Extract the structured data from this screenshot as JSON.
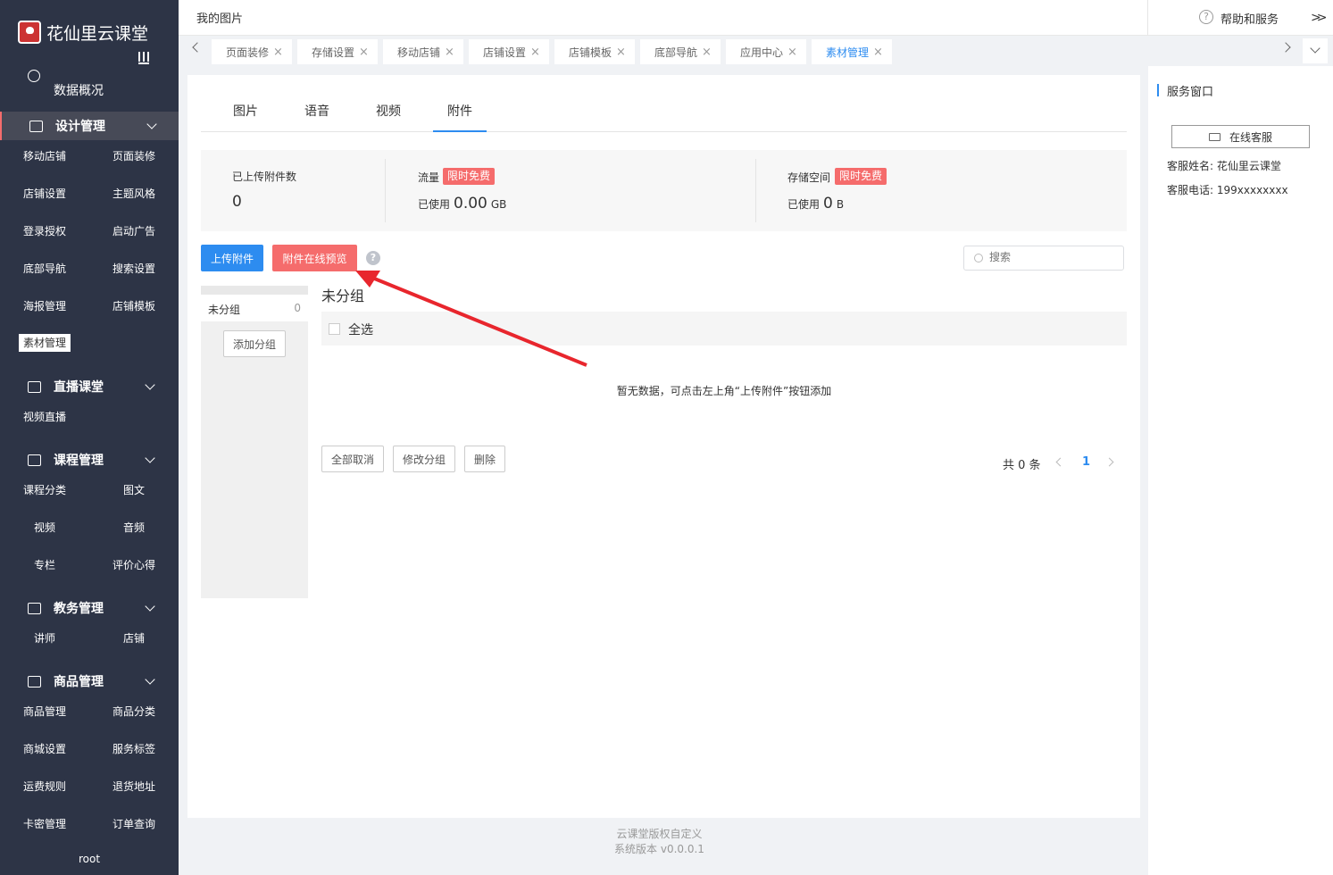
{
  "sidebar": {
    "logo_text": "花仙里云课堂",
    "overview": "数据概况",
    "sections": [
      {
        "label": "设计管理",
        "items": [
          "移动店铺",
          "页面装修",
          "店铺设置",
          "主题风格",
          "登录授权",
          "启动广告",
          "底部导航",
          "搜索设置",
          "海报管理",
          "店铺模板",
          "素材管理"
        ]
      },
      {
        "label": "直播课堂",
        "items": [
          "视频直播"
        ]
      },
      {
        "label": "课程管理",
        "items": [
          "课程分类",
          "图文",
          "视频",
          "音频",
          "专栏",
          "评价心得"
        ]
      },
      {
        "label": "教务管理",
        "items": [
          "讲师",
          "店铺"
        ]
      },
      {
        "label": "商品管理",
        "items": [
          "商品管理",
          "商品分类",
          "商城设置",
          "服务标签",
          "运费规则",
          "退货地址",
          "卡密管理",
          "订单查询"
        ]
      }
    ],
    "user": "root"
  },
  "header": {
    "title": "我的图片",
    "help": "帮助和服务"
  },
  "tabs": [
    "页面装修",
    "存储设置",
    "移动店铺",
    "店铺设置",
    "店铺模板",
    "底部导航",
    "应用中心",
    "素材管理"
  ],
  "inner_tabs": [
    "图片",
    "语音",
    "视频",
    "附件"
  ],
  "stats": {
    "uploaded_label": "已上传附件数",
    "uploaded_value": "0",
    "traffic_label": "流量",
    "storage_label": "存储空间",
    "free_badge": "限时免费",
    "used_label": "已使用",
    "traffic_value": "0.00",
    "traffic_unit": "GB",
    "storage_value": "0",
    "storage_unit": "B"
  },
  "actions": {
    "upload": "上传附件",
    "preview": "附件在线预览",
    "search_placeholder": "搜索"
  },
  "groups": {
    "item_name": "未分组",
    "item_count": "0",
    "add": "添加分组",
    "title": "未分组",
    "select_all": "全选"
  },
  "empty_text": "暂无数据，可点击左上角“上传附件”按钮添加",
  "bottom_actions": [
    "全部取消",
    "修改分组",
    "删除"
  ],
  "pagination": {
    "total": "共 0 条",
    "page": "1"
  },
  "footer": {
    "line1": "云课堂版权自定义",
    "line2": "系统版本 v0.0.0.1"
  },
  "service": {
    "title": "服务窗口",
    "button": "在线客服",
    "name_line": "客服姓名: 花仙里云课堂",
    "phone_line": "客服电话: 199xxxxxxxx"
  },
  "colors": {
    "sidebar": "#2d3446",
    "accent": "#2d8cf0",
    "danger": "#f56c6c",
    "annotation_arrow": "#e8262d"
  }
}
